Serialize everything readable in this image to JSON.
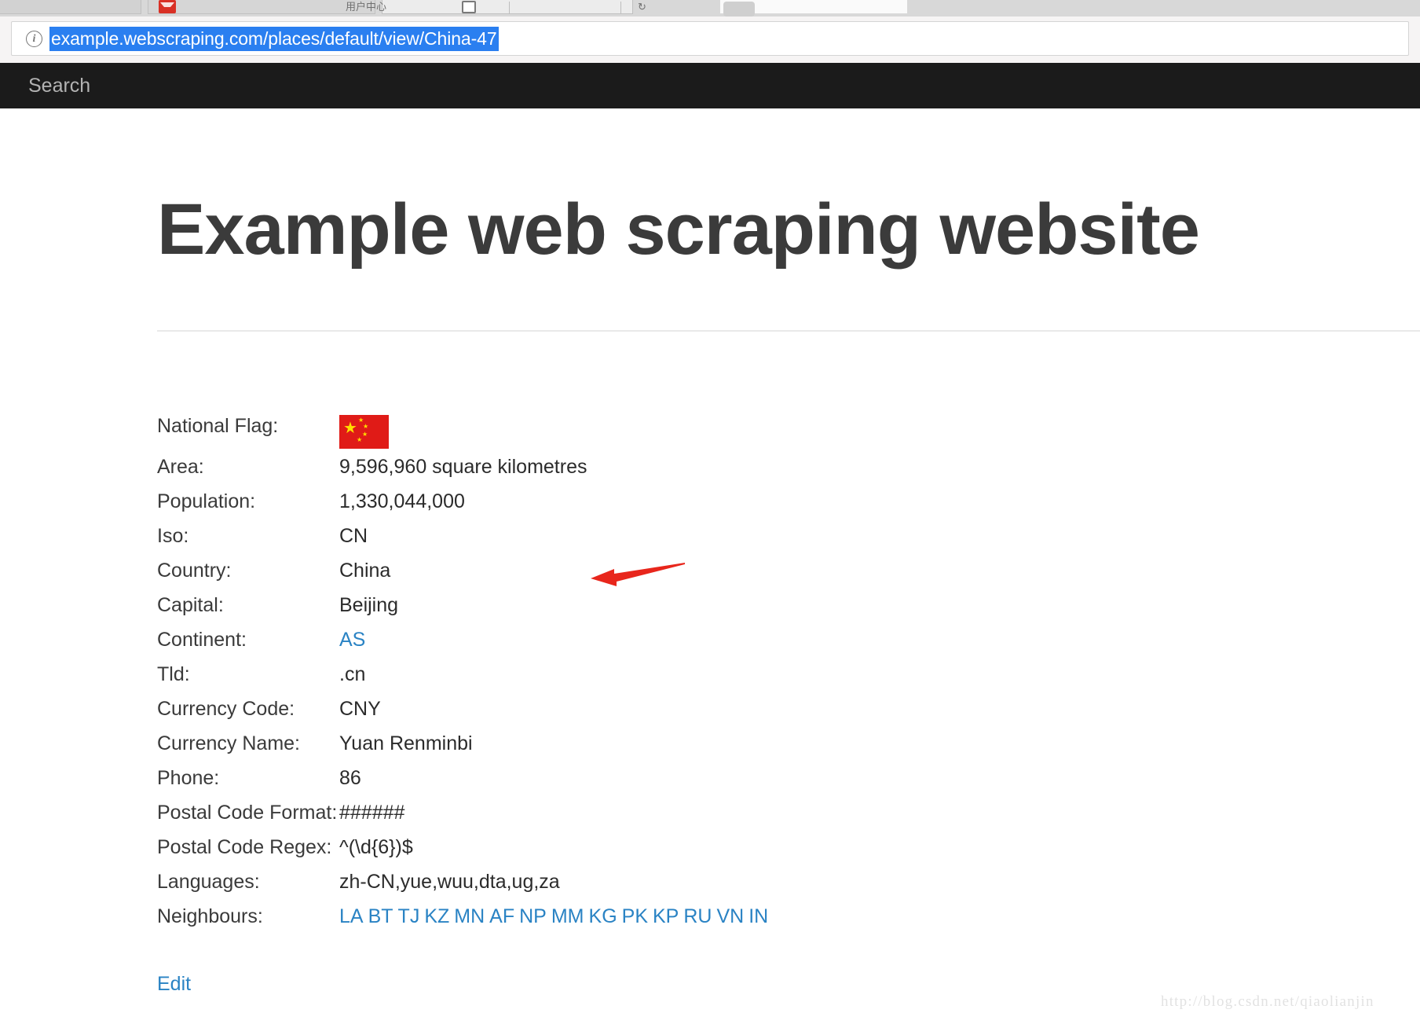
{
  "browser": {
    "url": "example.webscraping.com/places/default/view/China-47",
    "info_icon": "info-icon",
    "tabs": [
      {
        "label": "",
        "icon": "blank-icon"
      },
      {
        "label": "",
        "icon": "gmail-icon"
      },
      {
        "label": "用户中心",
        "icon": "page-icon"
      },
      {
        "label": "",
        "icon": "new-tab-icon"
      }
    ]
  },
  "site_nav": {
    "search_label": "Search"
  },
  "page": {
    "title": "Example web scraping website",
    "edit_label": "Edit"
  },
  "details": {
    "rows": [
      {
        "label": "National Flag:",
        "value": "",
        "type": "flag",
        "flag_alt": "china-flag"
      },
      {
        "label": "Area:",
        "value": "9,596,960 square kilometres",
        "type": "text"
      },
      {
        "label": "Population:",
        "value": "1,330,044,000",
        "type": "text"
      },
      {
        "label": "Iso:",
        "value": "CN",
        "type": "text"
      },
      {
        "label": "Country:",
        "value": "China",
        "type": "text"
      },
      {
        "label": "Capital:",
        "value": "Beijing",
        "type": "text"
      },
      {
        "label": "Continent:",
        "value": "AS",
        "type": "link"
      },
      {
        "label": "Tld:",
        "value": ".cn",
        "type": "text"
      },
      {
        "label": "Currency Code:",
        "value": "CNY",
        "type": "text"
      },
      {
        "label": "Currency Name:",
        "value": "Yuan Renminbi",
        "type": "text"
      },
      {
        "label": "Phone:",
        "value": "86",
        "type": "text"
      },
      {
        "label": "Postal Code Format:",
        "value": "######",
        "type": "text"
      },
      {
        "label": "Postal Code Regex:",
        "value": "^(\\d{6})$",
        "type": "text"
      },
      {
        "label": "Languages:",
        "value": "zh-CN,yue,wuu,dta,ug,za",
        "type": "text"
      },
      {
        "label": "Neighbours:",
        "value": "",
        "type": "links"
      }
    ],
    "neighbours": [
      "LA",
      "BT",
      "TJ",
      "KZ",
      "MN",
      "AF",
      "NP",
      "MM",
      "KG",
      "PK",
      "KP",
      "RU",
      "VN",
      "IN"
    ]
  },
  "annotation": {
    "arrow": "red-arrow-pointing-left",
    "color": "#e8261c"
  },
  "watermark": {
    "text": "http://blog.csdn.net/qiaolianjin"
  },
  "colors": {
    "navbar_bg": "#1b1b1b",
    "link": "#2a83c4",
    "heading": "#3b3b3b",
    "url_highlight": "#2a7ff0",
    "flag_red": "#e01b17",
    "flag_yellow": "#ffde00"
  }
}
